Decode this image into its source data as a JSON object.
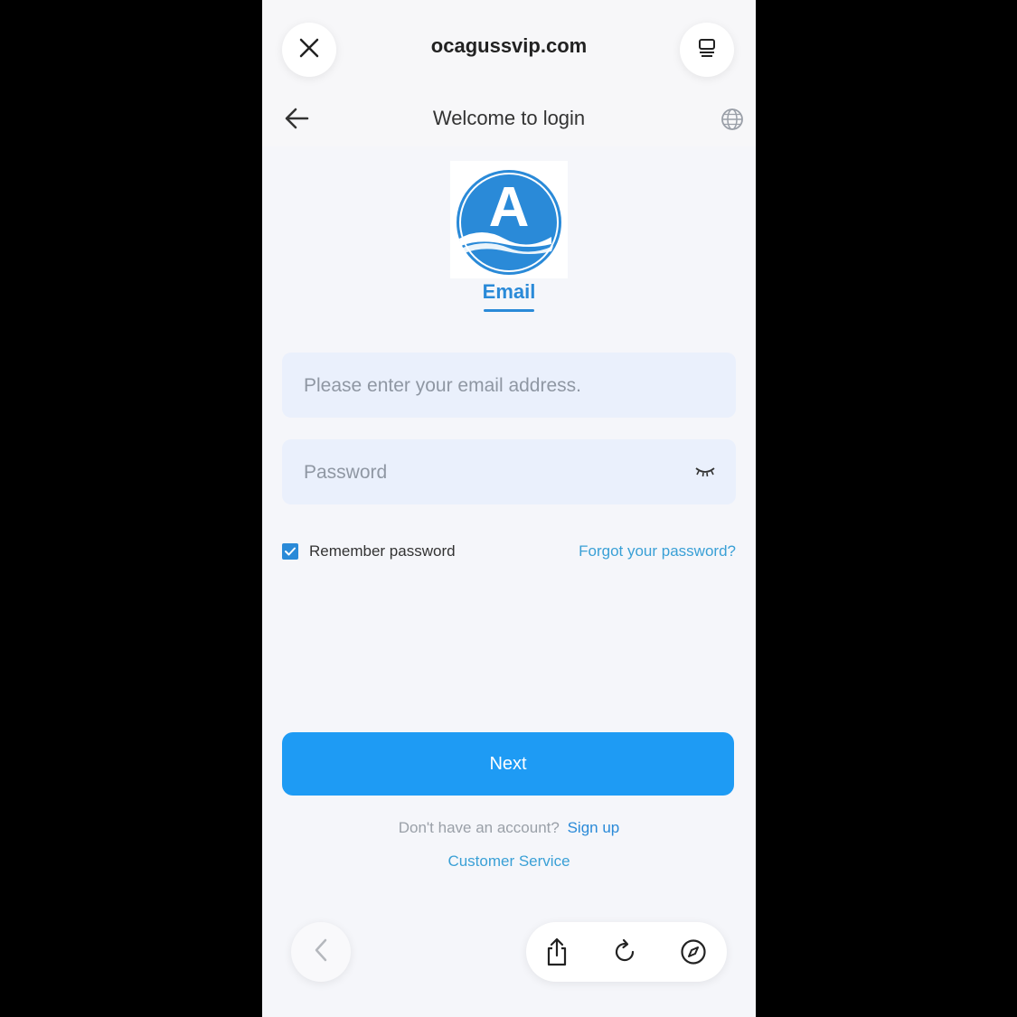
{
  "browser": {
    "url": "ocagussvip.com",
    "icons": [
      "close-icon",
      "tabs-icon",
      "share-icon",
      "reload-icon",
      "compass-icon",
      "chevron-left-icon"
    ]
  },
  "header": {
    "title": "Welcome to login",
    "icons": [
      "back-arrow-icon",
      "globe-icon"
    ]
  },
  "logo": {
    "letter": "A",
    "color": "#2a8ad8"
  },
  "tabs": {
    "email": "Email"
  },
  "form": {
    "email": {
      "placeholder": "Please enter your email address.",
      "value": ""
    },
    "password": {
      "placeholder": "Password",
      "value": ""
    },
    "remember_label": "Remember password",
    "remember_checked": true,
    "forgot_label": "Forgot your password?",
    "next_label": "Next"
  },
  "footer": {
    "no_account": "Don't have an account?",
    "signup": "Sign up",
    "service": "Customer Service"
  },
  "colors": {
    "accent": "#1e9bf4",
    "link": "#3aa0d6",
    "field_bg": "#eaf0fc"
  }
}
